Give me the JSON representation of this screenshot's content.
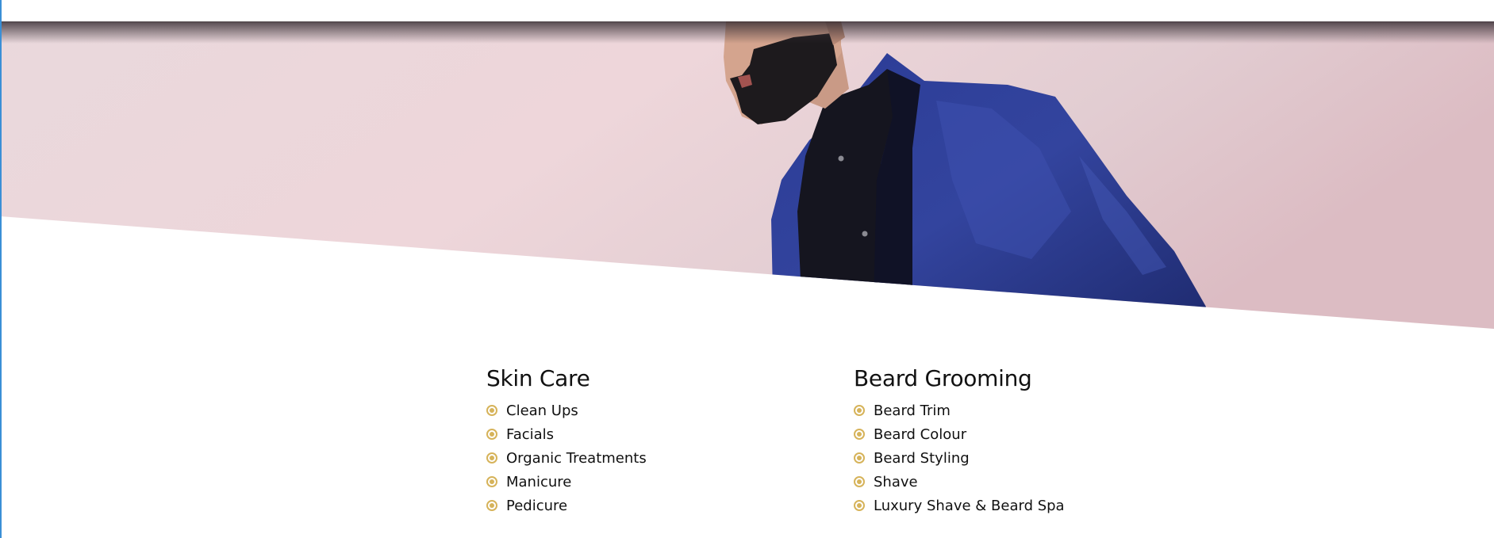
{
  "hero": {
    "image_name": "man-in-blue-suit-photo",
    "colors": {
      "background": "#e8d5da",
      "suit": "#2a3a8c",
      "shirt": "#15151f"
    }
  },
  "services": {
    "skin_care": {
      "title": "Skin Care",
      "items": [
        "Clean Ups",
        "Facials",
        "Organic Treatments",
        "Manicure",
        "Pedicure"
      ]
    },
    "beard_grooming": {
      "title": "Beard Grooming",
      "items": [
        "Beard Trim",
        "Beard Colour",
        "Beard Styling",
        "Shave",
        "Luxury Shave & Beard Spa"
      ]
    }
  },
  "colors": {
    "bullet_accent": "#d6b35a",
    "text": "#111111"
  }
}
